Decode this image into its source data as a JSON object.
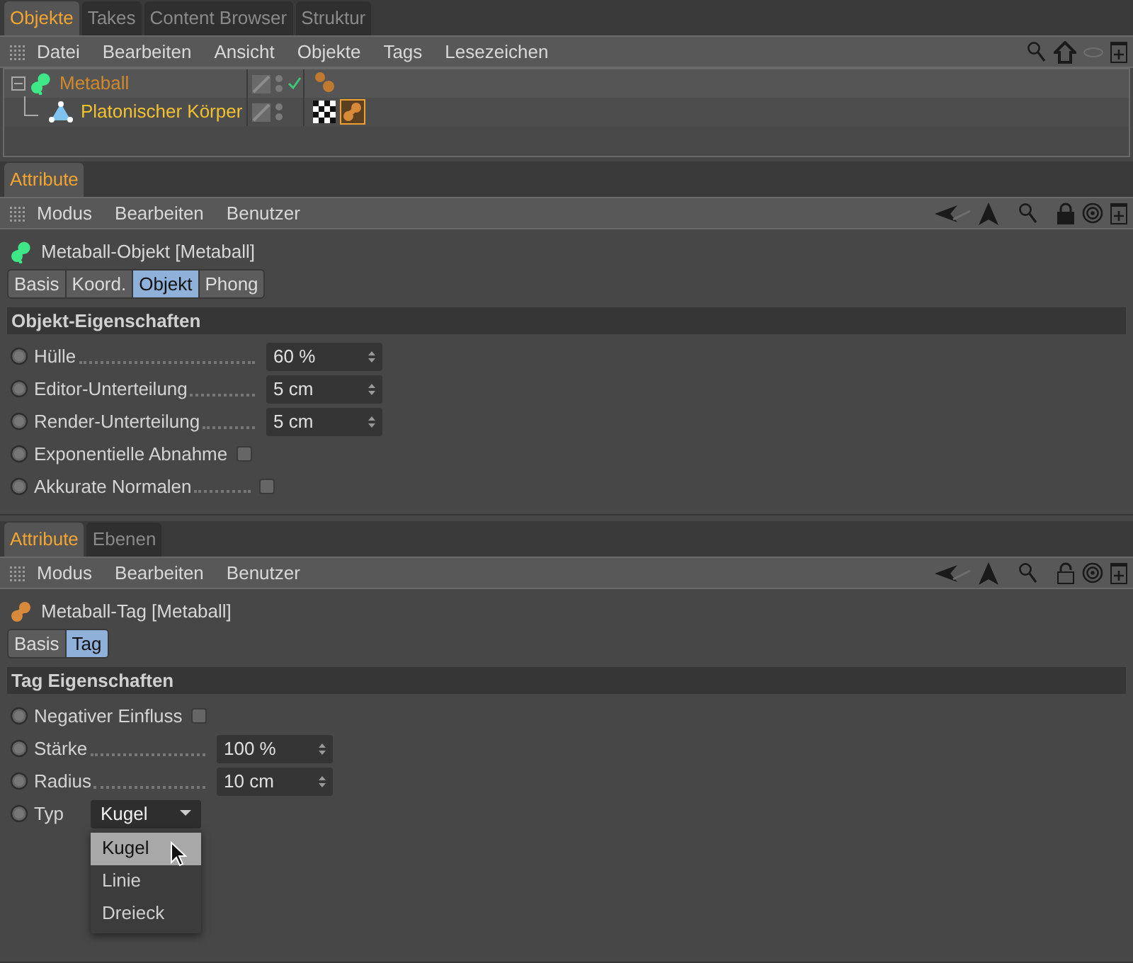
{
  "object_manager": {
    "tabs": [
      {
        "label": "Objekte",
        "selected": true
      },
      {
        "label": "Takes",
        "selected": false
      },
      {
        "label": "Content Browser",
        "selected": false
      },
      {
        "label": "Struktur",
        "selected": false
      }
    ],
    "menu": [
      "Datei",
      "Bearbeiten",
      "Ansicht",
      "Objekte",
      "Tags",
      "Lesezeichen"
    ],
    "objects": [
      {
        "name": "Metaball",
        "color": "#d08a2c",
        "expanded": true,
        "kind": "metaball",
        "enabled": true,
        "tags": [
          {
            "kind": "metaball-plain",
            "selected": false
          }
        ],
        "children": [
          {
            "name": "Platonischer Körper",
            "color": "#f2c230",
            "kind": "platonic",
            "enabled": false,
            "tags": [
              {
                "kind": "checker",
                "selected": false
              },
              {
                "kind": "metaball",
                "selected": true
              }
            ]
          }
        ]
      }
    ]
  },
  "attribute_panels": [
    {
      "tabs": [
        {
          "label": "Attribute",
          "selected": true
        }
      ],
      "menu": [
        "Modus",
        "Bearbeiten",
        "Benutzer"
      ],
      "locked": true,
      "title": "Metaball-Objekt [Metaball]",
      "kind": "metaball-object",
      "subtabs": [
        {
          "label": "Basis",
          "selected": false
        },
        {
          "label": "Koord.",
          "selected": false
        },
        {
          "label": "Objekt",
          "selected": true
        },
        {
          "label": "Phong",
          "selected": false
        }
      ],
      "section": "Objekt-Eigenschaften",
      "params": [
        {
          "kind": "number",
          "label": "Hülle",
          "value": "60 %"
        },
        {
          "kind": "number",
          "label": "Editor-Unterteilung",
          "value": "5 cm"
        },
        {
          "kind": "number",
          "label": "Render-Unterteilung",
          "value": "5 cm"
        },
        {
          "kind": "checkbox",
          "label": "Exponentielle Abnahme",
          "checked": false
        },
        {
          "kind": "checkbox",
          "label": "Akkurate Normalen",
          "checked": false
        }
      ]
    },
    {
      "tabs": [
        {
          "label": "Attribute",
          "selected": true
        },
        {
          "label": "Ebenen",
          "selected": false
        }
      ],
      "menu": [
        "Modus",
        "Bearbeiten",
        "Benutzer"
      ],
      "locked": false,
      "title": "Metaball-Tag [Metaball]",
      "kind": "metaball-tag",
      "subtabs": [
        {
          "label": "Basis",
          "selected": false
        },
        {
          "label": "Tag",
          "selected": true
        }
      ],
      "section": "Tag Eigenschaften",
      "params": [
        {
          "kind": "checkbox",
          "label": "Negativer Einfluss",
          "checked": false
        },
        {
          "kind": "number",
          "label": "Stärke",
          "value": "100 %"
        },
        {
          "kind": "number",
          "label": "Radius",
          "value": "10 cm"
        },
        {
          "kind": "dropdown",
          "label": "Typ",
          "value": "Kugel",
          "expanded": true,
          "options": [
            {
              "label": "Kugel",
              "selected": true
            },
            {
              "label": "Linie",
              "selected": false
            },
            {
              "label": "Dreieck",
              "selected": false
            }
          ]
        }
      ]
    }
  ]
}
